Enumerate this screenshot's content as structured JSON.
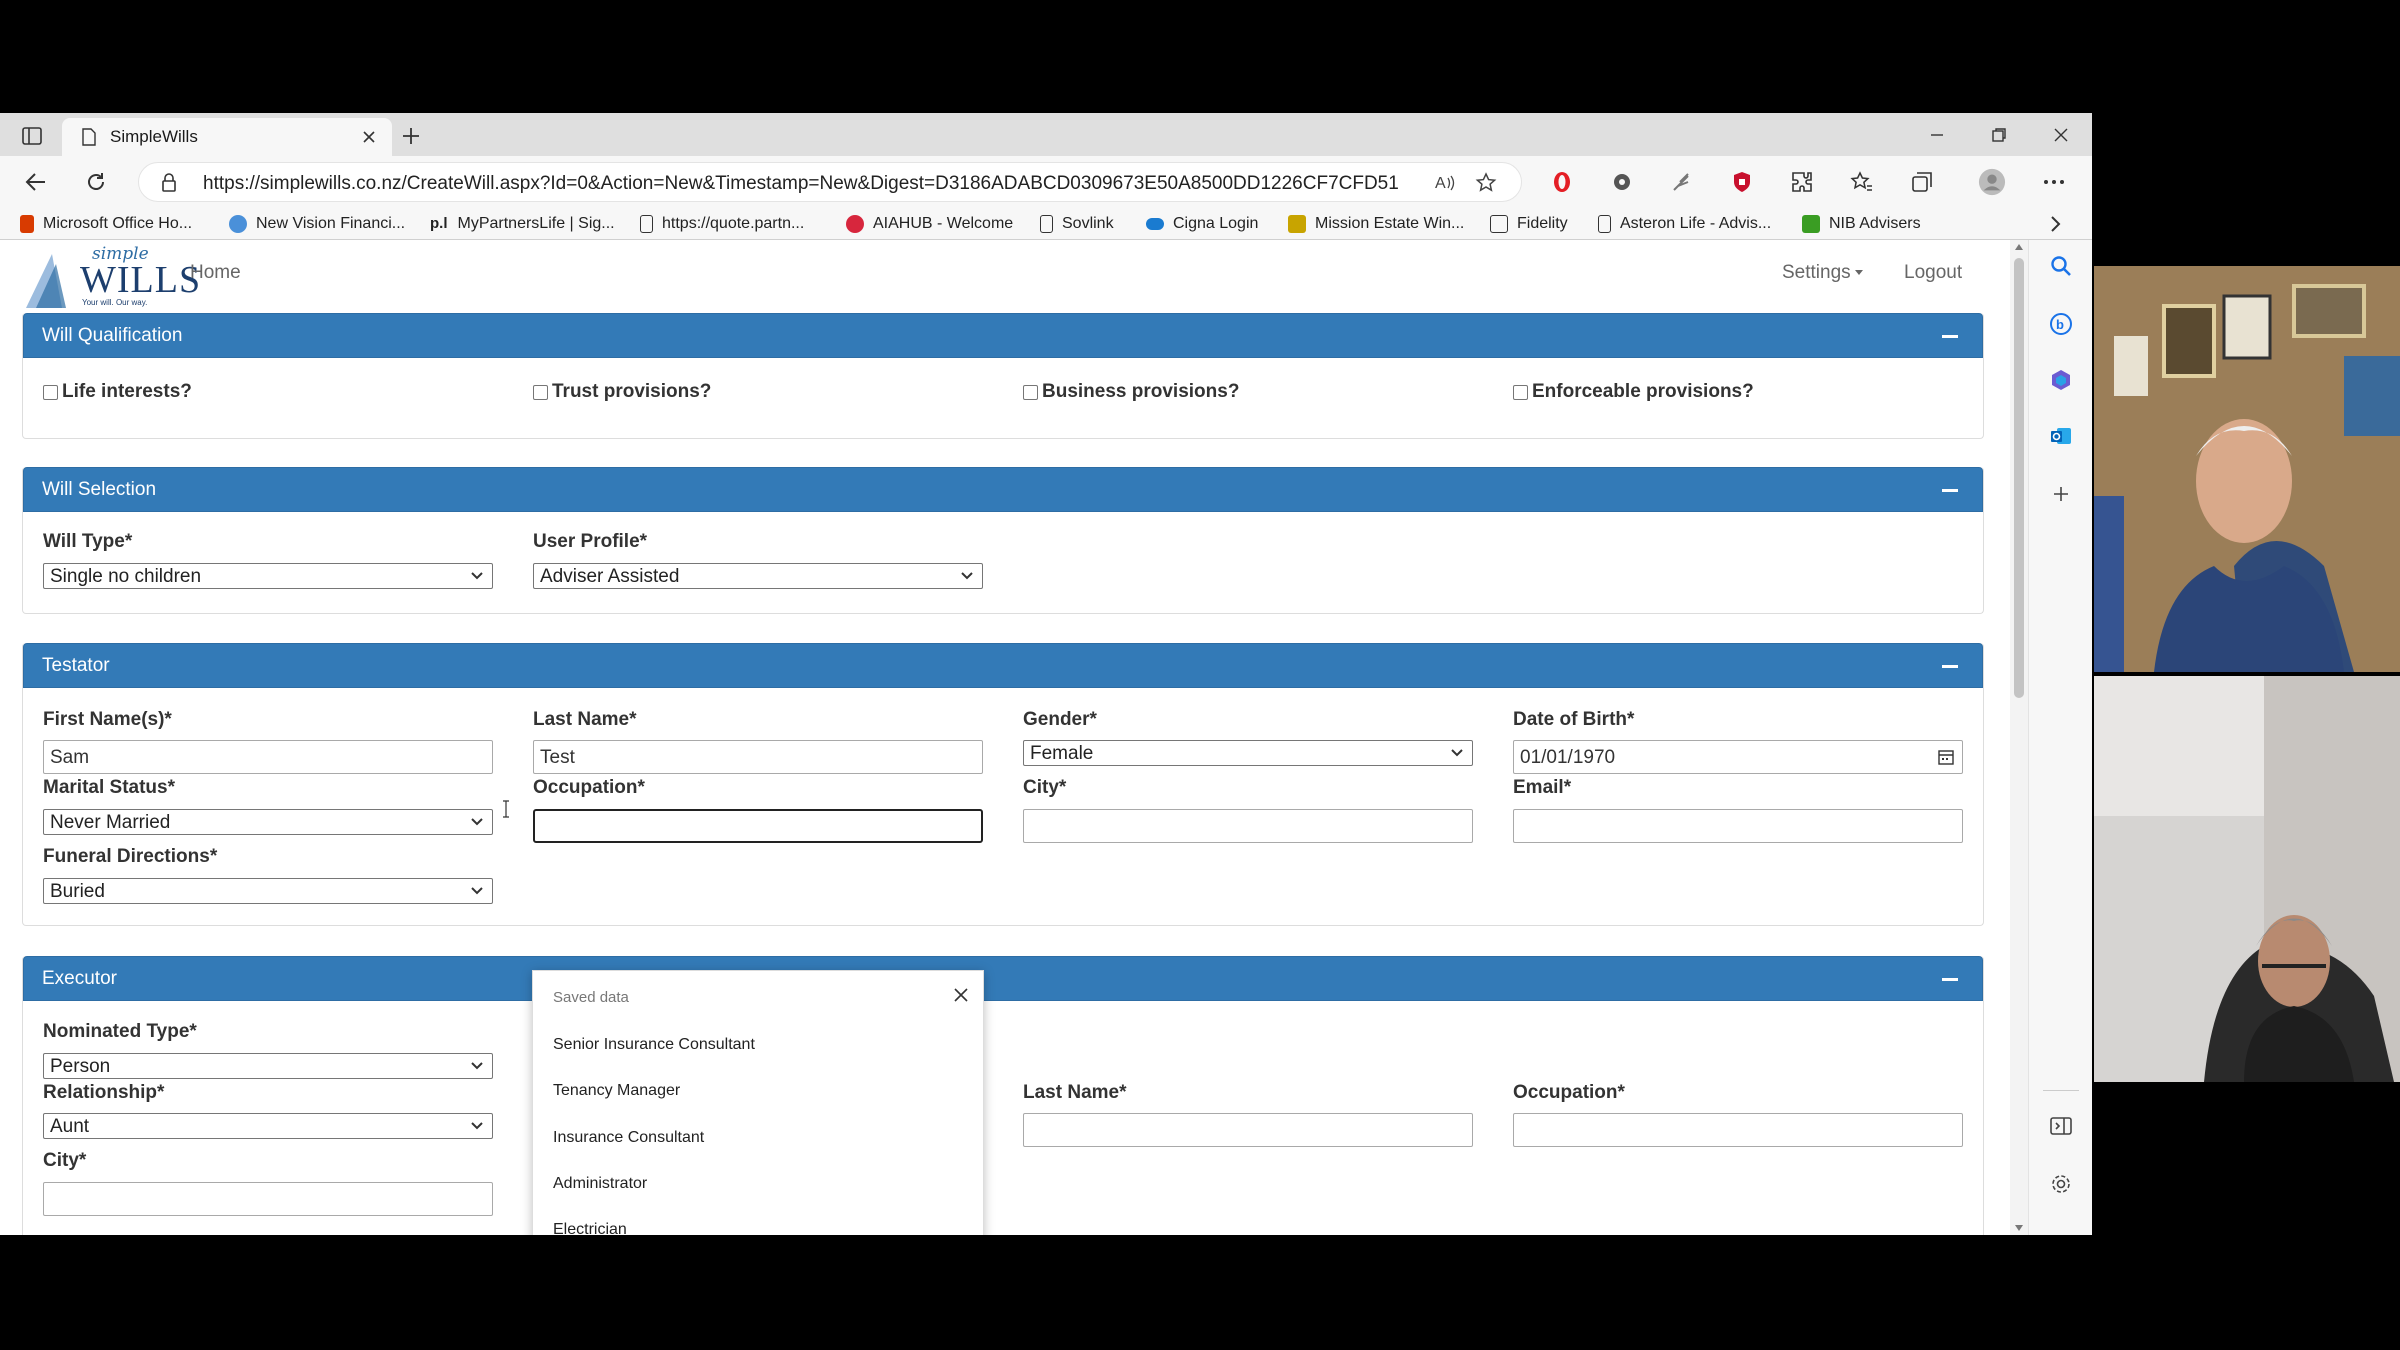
{
  "browser": {
    "tab_title": "SimpleWills",
    "url": "https://simplewills.co.nz/CreateWill.aspx?Id=0&Action=New&Timestamp=New&Digest=D3186ADABCD0309673E50A8500DD1226CF7CFD51",
    "bookmarks": [
      {
        "label": "Microsoft Office Ho...",
        "color": "#d83b01"
      },
      {
        "label": "New Vision Financi...",
        "color": "#4a90d9"
      },
      {
        "label": "MyPartnersLife | Sig...",
        "color": "#222222"
      },
      {
        "label": "https://quote.partn...",
        "color": "#ffffff"
      },
      {
        "label": "AIAHUB - Welcome",
        "color": "#d7263d"
      },
      {
        "label": "Sovlink",
        "color": "#ffffff"
      },
      {
        "label": "Cigna Login",
        "color": "#1a7bd0"
      },
      {
        "label": "Mission Estate Win...",
        "color": "#c8a400"
      },
      {
        "label": "Fidelity",
        "color": "#ffffff"
      },
      {
        "label": "Asteron Life - Advis...",
        "color": "#ffffff"
      },
      {
        "label": "NIB Advisers",
        "color": "#3a9d23"
      }
    ]
  },
  "site": {
    "logo_line1": "simple",
    "logo_line2": "WILLS",
    "logo_tagline": "Your will. Our way.",
    "nav_home": "Home",
    "nav_settings": "Settings",
    "nav_logout": "Logout"
  },
  "qualification": {
    "title": "Will Qualification",
    "options": [
      "Life interests?",
      "Trust provisions?",
      "Business provisions?",
      "Enforceable provisions?"
    ]
  },
  "selection": {
    "title": "Will Selection",
    "will_type_label": "Will Type*",
    "will_type_value": "Single no children",
    "user_profile_label": "User Profile*",
    "user_profile_value": "Adviser Assisted"
  },
  "testator": {
    "title": "Testator",
    "first_name_label": "First Name(s)*",
    "first_name_value": "Sam",
    "last_name_label": "Last Name*",
    "last_name_value": "Test",
    "gender_label": "Gender*",
    "gender_value": "Female",
    "dob_label": "Date of Birth*",
    "dob_value": "01/01/1970",
    "marital_label": "Marital Status*",
    "marital_value": "Never Married",
    "occupation_label": "Occupation*",
    "occupation_value": "",
    "city_label": "City*",
    "email_label": "Email*",
    "funeral_label": "Funeral Directions*",
    "funeral_value": "Buried"
  },
  "autocomplete": {
    "header": "Saved data",
    "items": [
      "Senior Insurance Consultant",
      "Tenancy Manager",
      "Insurance Consultant",
      "Administrator",
      "Electrician"
    ]
  },
  "executor": {
    "title": "Executor",
    "nominated_label": "Nominated Type*",
    "nominated_value": "Person",
    "relationship_label": "Relationship*",
    "relationship_value": "Aunt",
    "last_name_label": "Last Name*",
    "occupation_label": "Occupation*",
    "city_label": "City*"
  },
  "colors": {
    "panel_header": "#337ab7",
    "text": "#333333"
  }
}
